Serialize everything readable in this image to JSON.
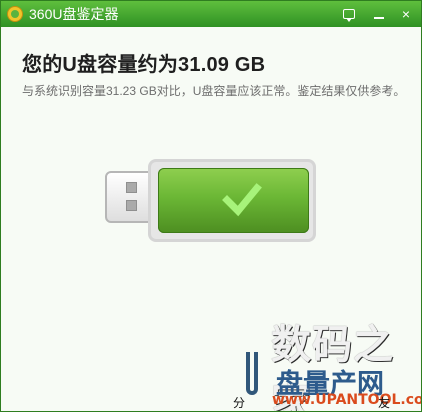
{
  "window": {
    "title": "360U盘鉴定器"
  },
  "header": {
    "capacity_headline": "您的U盘容量约为31.09 GB",
    "comparison_text": "与系统识别容量31.23 GB对比，U盘容量应该正常。鉴定结果仅供参考。"
  },
  "watermark": {
    "line1": "数码之家",
    "line2": "盘量产网",
    "line3": "www.UPANTOOL.com"
  },
  "footer": {
    "prefix": "分",
    "suffix": "友"
  },
  "icons": {
    "app": "360-app-icon",
    "feedback": "feedback-icon",
    "minimize": "minimize-icon",
    "close": "close-icon",
    "usb_status": "usb-check-icon"
  },
  "colors": {
    "title_bar": "#48a934",
    "usb_green": "#6bb735",
    "check": "#a7f37a"
  }
}
